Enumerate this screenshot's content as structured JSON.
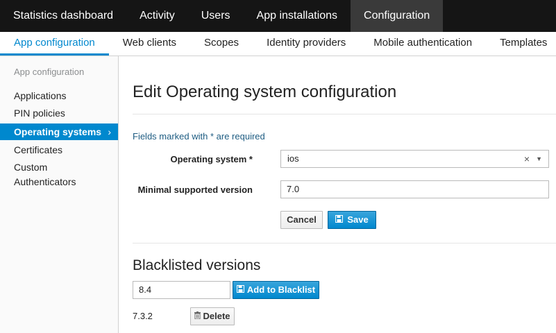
{
  "topnav": {
    "tabs": [
      {
        "label": "Statistics dashboard"
      },
      {
        "label": "Activity"
      },
      {
        "label": "Users"
      },
      {
        "label": "App installations"
      },
      {
        "label": "Configuration"
      }
    ]
  },
  "subnav": {
    "tabs": [
      {
        "label": "App configuration"
      },
      {
        "label": "Web clients"
      },
      {
        "label": "Scopes"
      },
      {
        "label": "Identity providers"
      },
      {
        "label": "Mobile authentication"
      },
      {
        "label": "Templates"
      }
    ]
  },
  "sidebar": {
    "heading": "App configuration",
    "items": [
      {
        "label": "Applications"
      },
      {
        "label": "PIN policies"
      },
      {
        "label": "Operating systems"
      },
      {
        "label": "Certificates"
      },
      {
        "label": "Custom"
      },
      {
        "label": "Authenticators"
      }
    ],
    "active_chevron": "›"
  },
  "main": {
    "title": "Edit Operating system configuration",
    "required_note": "Fields marked with * are required",
    "os_label": "Operating system *",
    "os_value": "ios",
    "os_clear": "×",
    "os_caret": "▼",
    "min_version_label": "Minimal supported version",
    "min_version_value": "7.0",
    "cancel_label": "Cancel",
    "save_label": "Save",
    "blacklist": {
      "title": "Blacklisted versions",
      "input_value": "8.4",
      "add_label": "Add to Blacklist",
      "items": [
        {
          "version": "7.3.2",
          "delete_label": "Delete"
        }
      ]
    }
  },
  "colors": {
    "accent": "#0088ce",
    "topnav_bg": "#151515",
    "topnav_active": "#3a3a3a"
  },
  "icons": {
    "save": "save-icon",
    "add": "save-icon",
    "delete": "trash-icon",
    "chevron": "chevron-right-icon"
  }
}
